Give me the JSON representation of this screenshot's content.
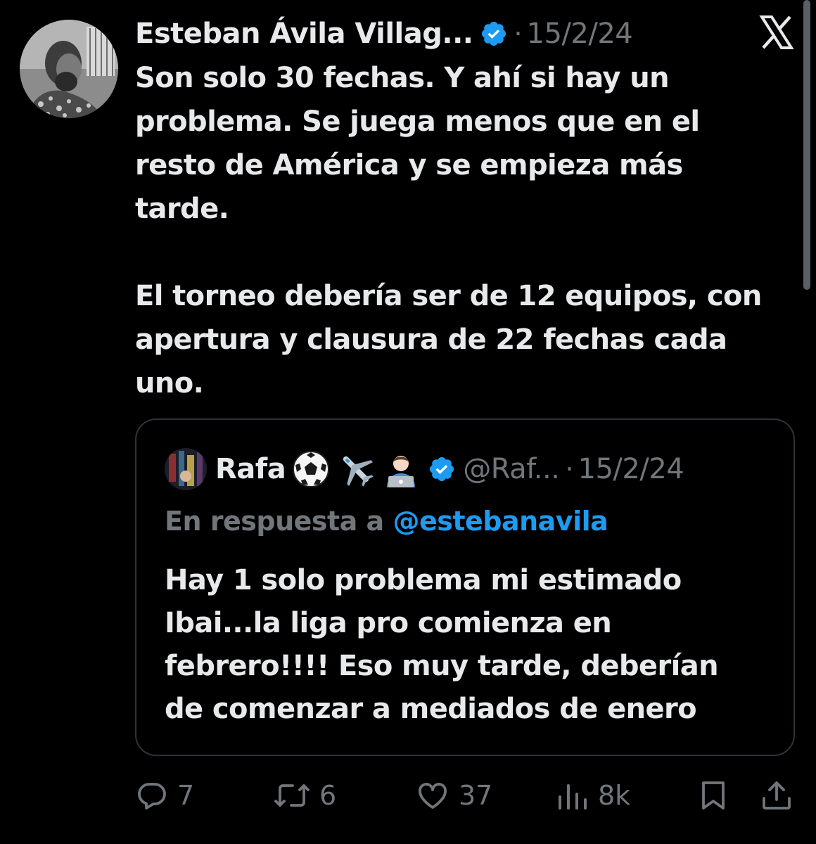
{
  "tweet": {
    "author_name": "Esteban Ávila Villag...",
    "separator": "·",
    "date": "15/2/24",
    "text": "Son solo 30 fechas. Y ahí si hay un\nproblema. Se juega menos que en el\nresto de América y se empieza más\ntarde.\n\nEl torneo debería ser de 12 equipos, con\napertura y clausura de 22 fechas cada\nuno."
  },
  "quoted": {
    "author_name": "Rafa",
    "emojis": [
      "soccer-ball",
      "airplane",
      "technologist"
    ],
    "handle": "@Raf...",
    "separator": "·",
    "date": "15/2/24",
    "reply_prefix": "En respuesta a ",
    "reply_mention": "@estebanavila",
    "text": "Hay 1 solo problema mi estimado\nIbai...la liga pro comienza en\nfebrero!!!! Eso muy tarde, deberían\nde comenzar a mediados de enero"
  },
  "actions": {
    "replies": "7",
    "retweets": "6",
    "likes": "37",
    "views": "8k"
  },
  "colors": {
    "background": "#000000",
    "text_primary": "#e7e9ea",
    "text_secondary": "#71767b",
    "accent": "#1d9bf0",
    "border": "#2f3336"
  },
  "icons": {
    "reply": "reply-icon",
    "retweet": "retweet-icon",
    "like": "like-icon",
    "views": "views-icon",
    "bookmark": "bookmark-icon",
    "share": "share-icon",
    "platform": "x-logo-icon",
    "verified": "verified-badge-icon"
  }
}
